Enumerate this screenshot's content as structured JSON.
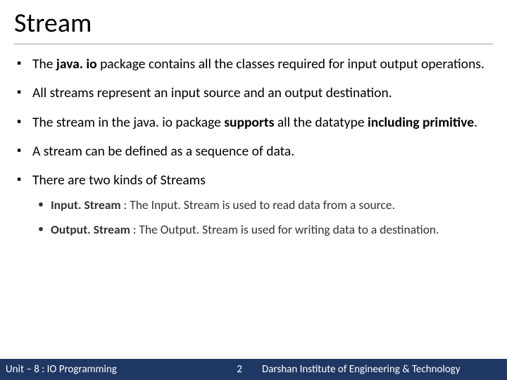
{
  "title": "Stream",
  "bullets": {
    "b1_a": "The ",
    "b1_b": "java. io",
    "b1_c": " package contains all the classes required for input output operations.",
    "b2": "All streams represent an input source and an output destination.",
    "b3_a": "The stream in the java. io package ",
    "b3_b": "supports",
    "b3_c": " all the datatype ",
    "b3_d": "including primitive",
    "b3_e": ".",
    "b4": "A stream can be defined as a sequence of data.",
    "b5": "There are two kinds of Streams",
    "s1_a": "Input. Stream",
    "s1_b": " : The Input. Stream is used to read data from a source.",
    "s2_a": "Output. Stream",
    "s2_b": " : The Output. Stream is used for writing data to a destination."
  },
  "footer": {
    "left": "Unit – 8 : IO Programming",
    "page": "2",
    "right": "Darshan Institute of Engineering & Technology"
  }
}
